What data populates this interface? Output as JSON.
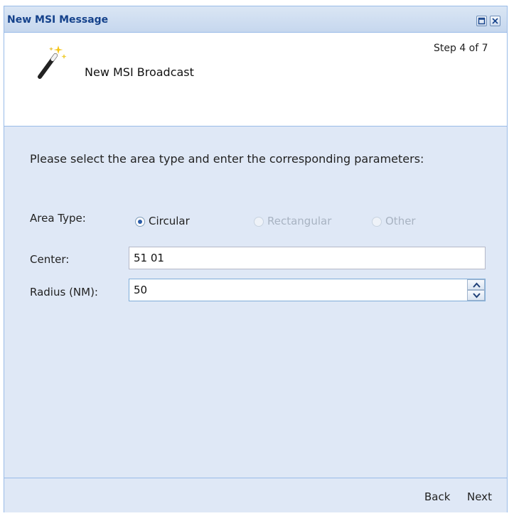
{
  "window": {
    "title": "New MSI Message",
    "controls": [
      "maximize-icon",
      "close-icon"
    ]
  },
  "header": {
    "icon": "magic-wand-icon",
    "title": "New MSI Broadcast",
    "step": "Step 4 of 7"
  },
  "form": {
    "instructions": "Please select the area type and enter the corresponding parameters:",
    "area_type_label": "Area Type:",
    "area_options": [
      {
        "label": "Circular",
        "selected": true,
        "enabled": true
      },
      {
        "label": "Rectangular",
        "selected": false,
        "enabled": false
      },
      {
        "label": "Other",
        "selected": false,
        "enabled": false
      }
    ],
    "center_label": "Center:",
    "center_value": "51 01",
    "radius_label": "Radius (NM):",
    "radius_value": "50"
  },
  "footer": {
    "back_label": "Back",
    "next_label": "Next"
  },
  "colors": {
    "title_text": "#15428b",
    "border": "#99bbe8",
    "body_bg": "#dfe8f6"
  }
}
